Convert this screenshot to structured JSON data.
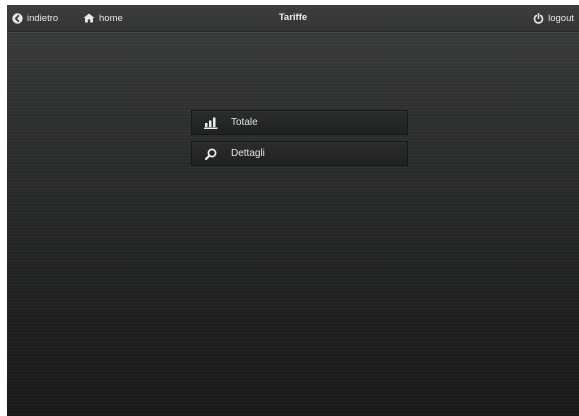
{
  "header": {
    "title": "Tariffe",
    "back_label": "indietro",
    "home_label": "home",
    "logout_label": "logout"
  },
  "icons": {
    "back": "circle-arrow-left-icon",
    "home": "house-icon",
    "logout": "power-icon",
    "totale": "bar-chart-icon",
    "dettagli": "magnifier-icon"
  },
  "menu": {
    "items": [
      {
        "label": "Totale",
        "icon": "bar-chart-icon"
      },
      {
        "label": "Dettagli",
        "icon": "magnifier-icon"
      }
    ]
  },
  "colors": {
    "background": "#222524",
    "text": "#e6e6e6"
  }
}
